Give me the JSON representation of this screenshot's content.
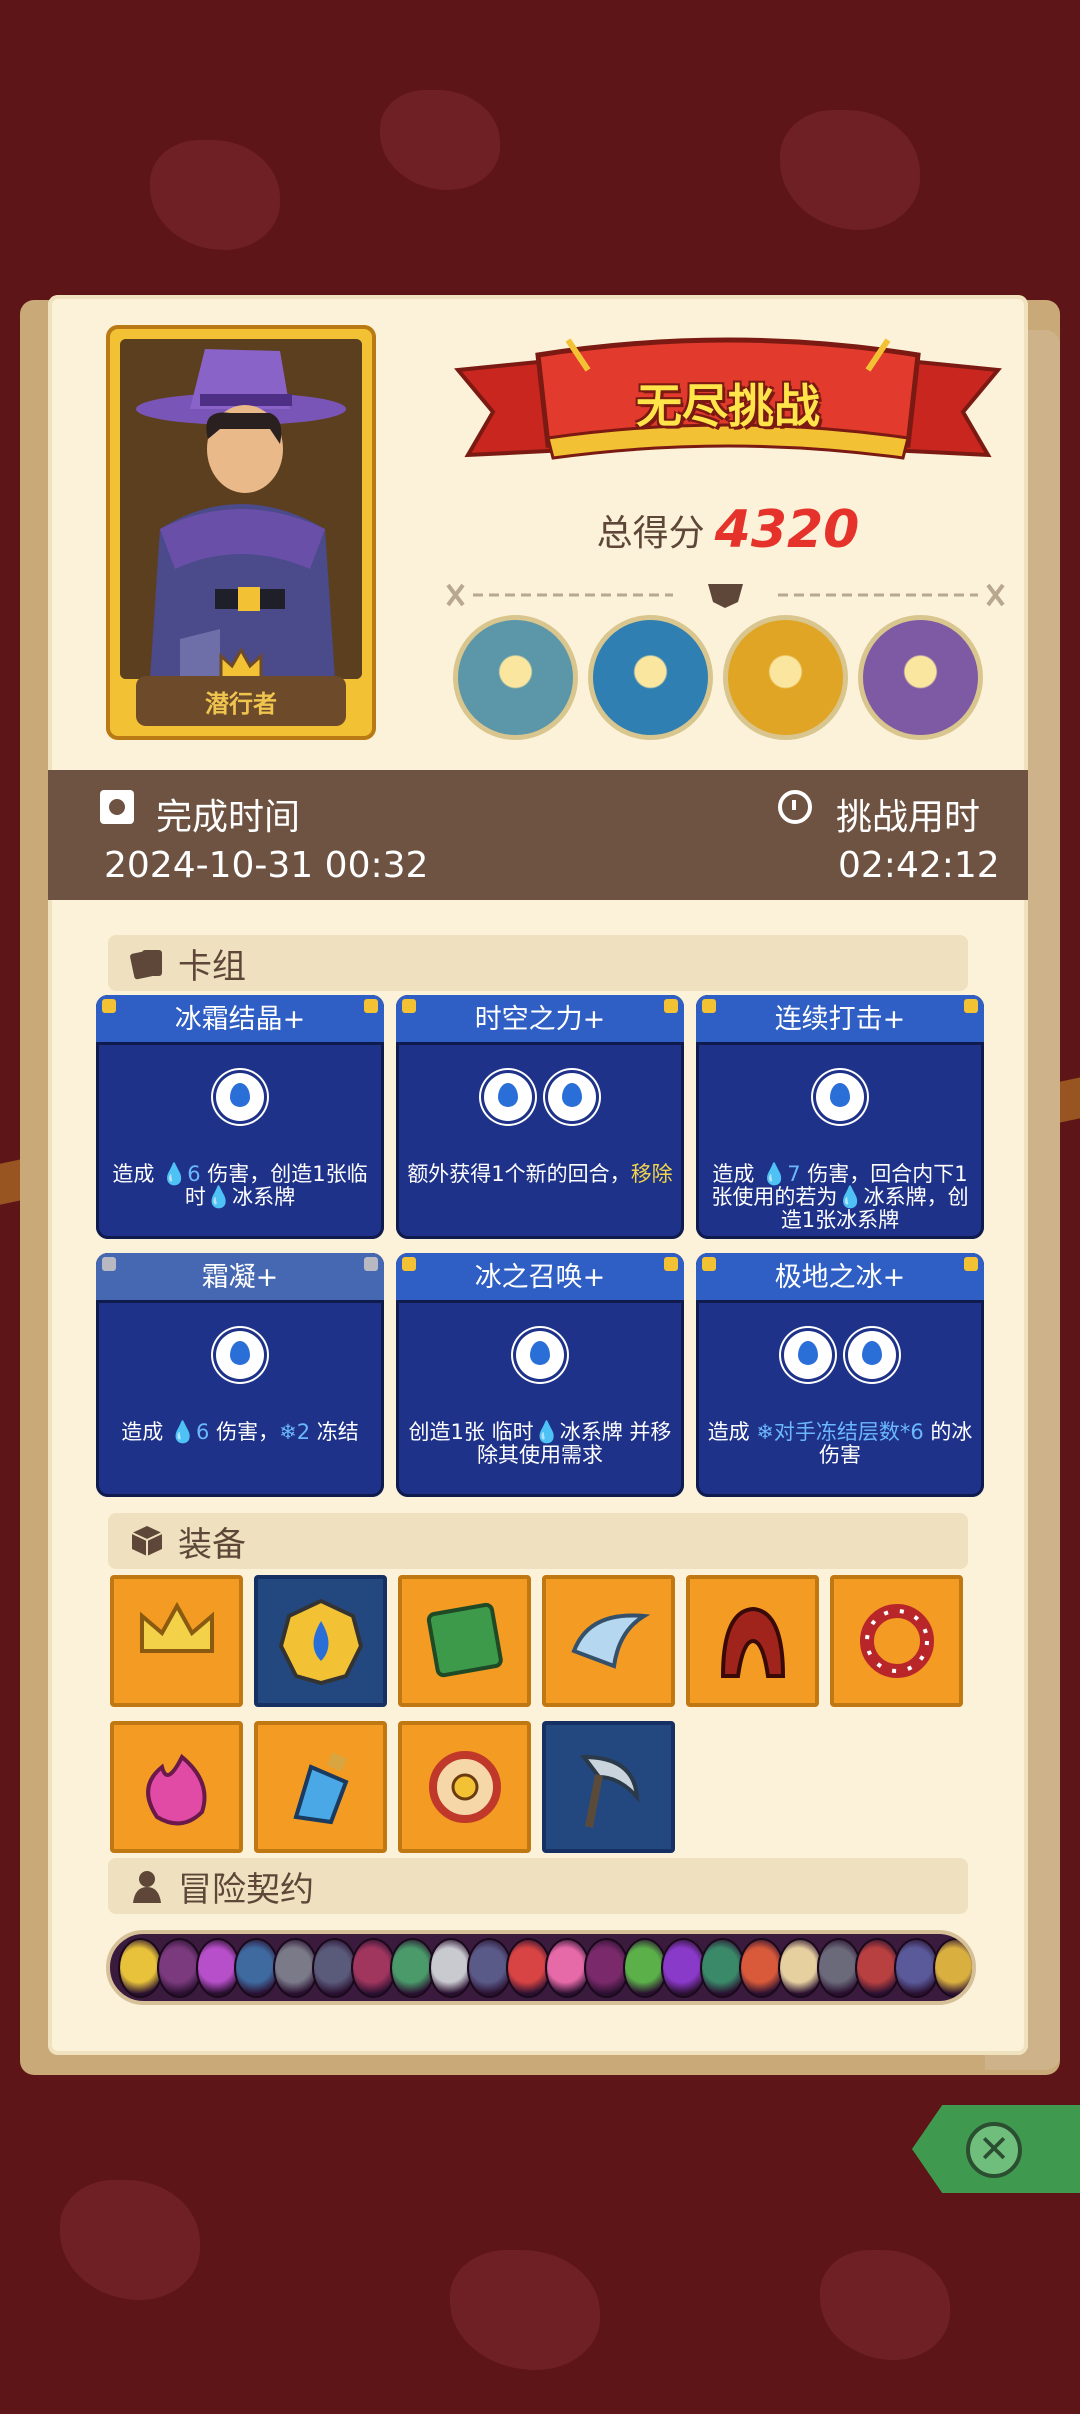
{
  "hero": {
    "name": "潜行者",
    "portrait_icon": "hero-portrait"
  },
  "challenge": {
    "banner": "无尽挑战",
    "score_label": "总得分",
    "score_value": "4320"
  },
  "bosses": [
    {
      "name": "boss-blue-monster-icon",
      "color": "#5b97a8"
    },
    {
      "name": "boss-crowned-spider-icon",
      "color": "#2f7fb2"
    },
    {
      "name": "boss-red-demon-icon",
      "color": "#e1a525"
    },
    {
      "name": "boss-purple-dragon-icon",
      "color": "#7d5aa3"
    }
  ],
  "time": {
    "finish_label": "完成时间",
    "finish_value": "2024-10-31 00:32",
    "used_label": "挑战用时",
    "used_value": "02:42:12"
  },
  "deck": {
    "title": "卡组",
    "cards": [
      {
        "title": "冰霜结晶+",
        "drops": 1,
        "desc_parts": [
          [
            "n",
            "造成 "
          ],
          [
            "b",
            "💧6"
          ],
          [
            "n",
            " 伤害，创造1张临时"
          ],
          [
            "b",
            "💧"
          ],
          [
            "n",
            "冰系牌"
          ]
        ]
      },
      {
        "title": "时空之力+",
        "drops": 2,
        "desc_parts": [
          [
            "n",
            "额外获得1个新的回合，"
          ],
          [
            "h",
            "移除"
          ]
        ]
      },
      {
        "title": "连续打击+",
        "drops": 1,
        "desc_parts": [
          [
            "n",
            "造成 "
          ],
          [
            "b",
            "💧7"
          ],
          [
            "n",
            " 伤害，回合内下1张使用的若为"
          ],
          [
            "b",
            "💧"
          ],
          [
            "n",
            "冰系牌，创造1张冰系牌"
          ]
        ]
      },
      {
        "title": "霜凝+",
        "drops": 1,
        "grey": true,
        "desc_parts": [
          [
            "n",
            "造成 "
          ],
          [
            "b",
            "💧6"
          ],
          [
            "n",
            " 伤害，"
          ],
          [
            "b",
            "❄2"
          ],
          [
            "n",
            " 冻结"
          ]
        ]
      },
      {
        "title": "冰之召唤+",
        "drops": 1,
        "desc_parts": [
          [
            "n",
            "创造1张 临时"
          ],
          [
            "b",
            "💧"
          ],
          [
            "n",
            "冰系牌 并移除其使用需求"
          ]
        ]
      },
      {
        "title": "极地之冰+",
        "drops": 2,
        "desc_parts": [
          [
            "n",
            "造成 "
          ],
          [
            "b",
            "❄对手冻结层数*6"
          ],
          [
            "n",
            " 的冰伤害"
          ]
        ]
      }
    ]
  },
  "equipment": {
    "title": "装备",
    "items": [
      {
        "name": "crown-icon",
        "blue": false
      },
      {
        "name": "water-amulet-icon",
        "blue": true
      },
      {
        "name": "green-tome-icon",
        "blue": false
      },
      {
        "name": "horn-icon",
        "blue": false
      },
      {
        "name": "red-hood-icon",
        "blue": false
      },
      {
        "name": "spiked-collar-icon",
        "blue": false
      },
      {
        "name": "pink-flame-icon",
        "blue": false
      },
      {
        "name": "blue-potion-icon",
        "blue": false
      },
      {
        "name": "shield-ring-icon",
        "blue": false
      },
      {
        "name": "scythe-icon",
        "blue": true
      }
    ]
  },
  "contracts": {
    "title": "冒险契约",
    "colors": [
      "#e7c23a",
      "#7a3a7d",
      "#b64fc9",
      "#3f6aa0",
      "#7a7a88",
      "#5a5a7a",
      "#a0365e",
      "#4a9a6a",
      "#c9c9d0",
      "#5a5a88",
      "#d84444",
      "#e66aa8",
      "#7a2a6a",
      "#5bb04a",
      "#8a3ac9",
      "#3a8a6a",
      "#d85a3a",
      "#e6d0a0",
      "#6a6a7a",
      "#b84040",
      "#5a5a9a",
      "#d9b040"
    ]
  },
  "close": {
    "icon": "close-icon",
    "glyph": "✕"
  }
}
